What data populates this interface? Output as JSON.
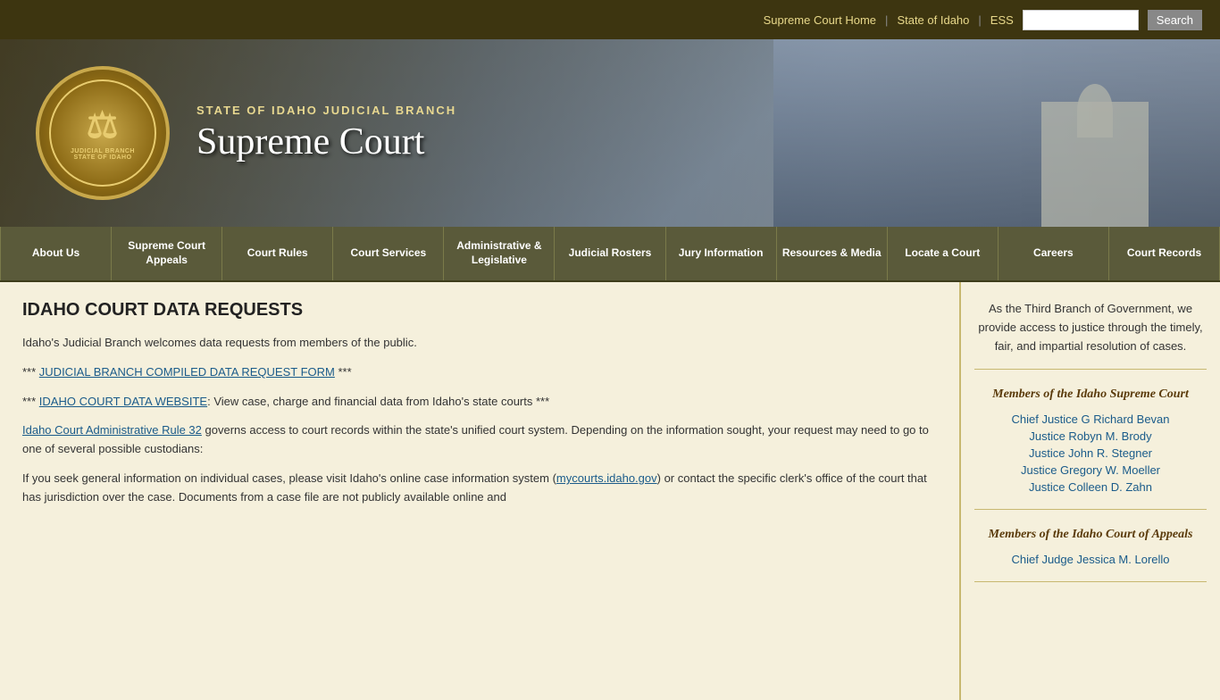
{
  "topbar": {
    "link1": "Supreme Court Home",
    "link2": "State of Idaho",
    "link3": "ESS",
    "search_placeholder": "",
    "search_btn": "Search"
  },
  "banner": {
    "seal_line1": "JUDICIAL",
    "seal_line2": "BRANCH",
    "seal_line3": "STATE OF IDAHO",
    "subtitle": "STATE OF IDAHO JUDICIAL BRANCH",
    "title": "Supreme Court"
  },
  "nav": {
    "items": [
      {
        "label": "About Us"
      },
      {
        "label": "Supreme Court Appeals"
      },
      {
        "label": "Court Rules"
      },
      {
        "label": "Court Services"
      },
      {
        "label": "Administrative & Legislative"
      },
      {
        "label": "Judicial Rosters"
      },
      {
        "label": "Jury Information"
      },
      {
        "label": "Resources & Media"
      },
      {
        "label": "Locate a Court"
      },
      {
        "label": "Careers"
      },
      {
        "label": "Court Records"
      }
    ]
  },
  "content": {
    "title": "IDAHO COURT DATA REQUESTS",
    "intro": "Idaho's Judicial Branch welcomes data requests from members of the public.",
    "form_prefix": "*** ",
    "form_link": "JUDICIAL BRANCH COMPILED DATA REQUEST FORM",
    "form_suffix": " ***",
    "website_prefix": "*** ",
    "website_link": "IDAHO COURT DATA WEBSITE",
    "website_text": ": View case, charge and financial data from Idaho's state courts ***",
    "rule_link": "Idaho Court Administrative Rule 32",
    "rule_text": " governs access to court records within the state's unified court system. Depending on the information sought, your request may need to go to one of several possible custodians:",
    "case_info_prefix": "If you seek general information on individual cases, please visit Idaho's online case information system (",
    "case_info_link": "mycourts.idaho.gov",
    "case_info_suffix": ") or contact the specific clerk's office of the court that has jurisdiction over the case. Documents from a case file are not publicly available online and"
  },
  "sidebar": {
    "mission": "As the Third Branch of Government, we provide access to justice through the timely, fair, and impartial resolution of cases.",
    "section1_title": "Members of the Idaho Supreme Court",
    "section1_links": [
      "Chief Justice G Richard Bevan",
      "Justice Robyn M. Brody",
      "Justice John R. Stegner",
      "Justice Gregory W. Moeller",
      "Justice Colleen D. Zahn"
    ],
    "section2_title": "Members of the Idaho Court of Appeals",
    "section2_links": [
      "Chief Judge Jessica M. Lorello"
    ]
  }
}
